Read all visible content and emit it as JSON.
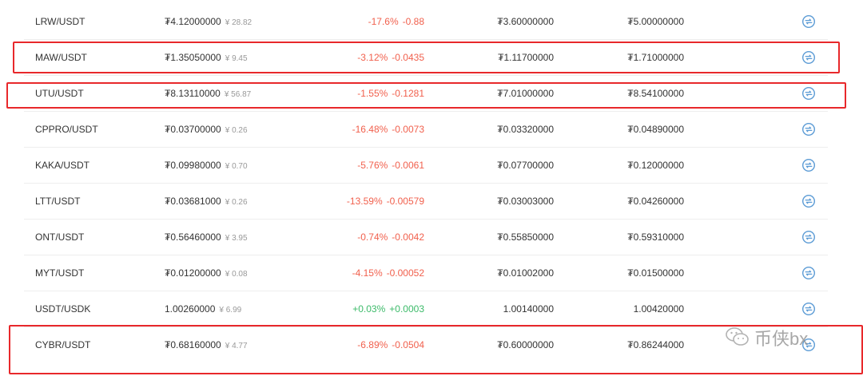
{
  "currency_symbol": "₮",
  "rows": [
    {
      "pair": "LRW/USDT",
      "price": "₮4.12000000",
      "cny": "¥ 28.82",
      "change_pct": "-17.6%",
      "change_abs": "-0.88",
      "direction": "down",
      "low": "₮3.60000000",
      "high": "₮5.00000000"
    },
    {
      "pair": "MAW/USDT",
      "price": "₮1.35050000",
      "cny": "¥ 9.45",
      "change_pct": "-3.12%",
      "change_abs": "-0.0435",
      "direction": "down",
      "low": "₮1.11700000",
      "high": "₮1.71000000"
    },
    {
      "pair": "UTU/USDT",
      "price": "₮8.13110000",
      "cny": "¥ 56.87",
      "change_pct": "-1.55%",
      "change_abs": "-0.1281",
      "direction": "down",
      "low": "₮7.01000000",
      "high": "₮8.54100000"
    },
    {
      "pair": "CPPRO/USDT",
      "price": "₮0.03700000",
      "cny": "¥ 0.26",
      "change_pct": "-16.48%",
      "change_abs": "-0.0073",
      "direction": "down",
      "low": "₮0.03320000",
      "high": "₮0.04890000"
    },
    {
      "pair": "KAKA/USDT",
      "price": "₮0.09980000",
      "cny": "¥ 0.70",
      "change_pct": "-5.76%",
      "change_abs": "-0.0061",
      "direction": "down",
      "low": "₮0.07700000",
      "high": "₮0.12000000"
    },
    {
      "pair": "LTT/USDT",
      "price": "₮0.03681000",
      "cny": "¥ 0.26",
      "change_pct": "-13.59%",
      "change_abs": "-0.00579",
      "direction": "down",
      "low": "₮0.03003000",
      "high": "₮0.04260000"
    },
    {
      "pair": "ONT/USDT",
      "price": "₮0.56460000",
      "cny": "¥ 3.95",
      "change_pct": "-0.74%",
      "change_abs": "-0.0042",
      "direction": "down",
      "low": "₮0.55850000",
      "high": "₮0.59310000"
    },
    {
      "pair": "MYT/USDT",
      "price": "₮0.01200000",
      "cny": "¥ 0.08",
      "change_pct": "-4.15%",
      "change_abs": "-0.00052",
      "direction": "down",
      "low": "₮0.01002000",
      "high": "₮0.01500000"
    },
    {
      "pair": "USDT/USDK",
      "price": "1.00260000",
      "cny": "¥ 6.99",
      "change_pct": "+0.03%",
      "change_abs": "+0.0003",
      "direction": "up",
      "low": "1.00140000",
      "high": "1.00420000"
    },
    {
      "pair": "CYBR/USDT",
      "price": "₮0.68160000",
      "cny": "¥ 4.77",
      "change_pct": "-6.89%",
      "change_abs": "-0.0504",
      "direction": "down",
      "low": "₮0.60000000",
      "high": "₮0.86244000"
    }
  ],
  "highlighted_pairs": [
    "MAW/USDT",
    "UTU/USDT",
    "CYBR/USDT"
  ],
  "action_icon": "trade-icon",
  "watermark": {
    "icon": "wechat-icon",
    "text": "币侠bx"
  },
  "colors": {
    "negative": "#f1604d",
    "positive": "#3dbb6a",
    "highlight": "#e8282b",
    "icon": "#5b9bd5",
    "muted": "#999999"
  }
}
